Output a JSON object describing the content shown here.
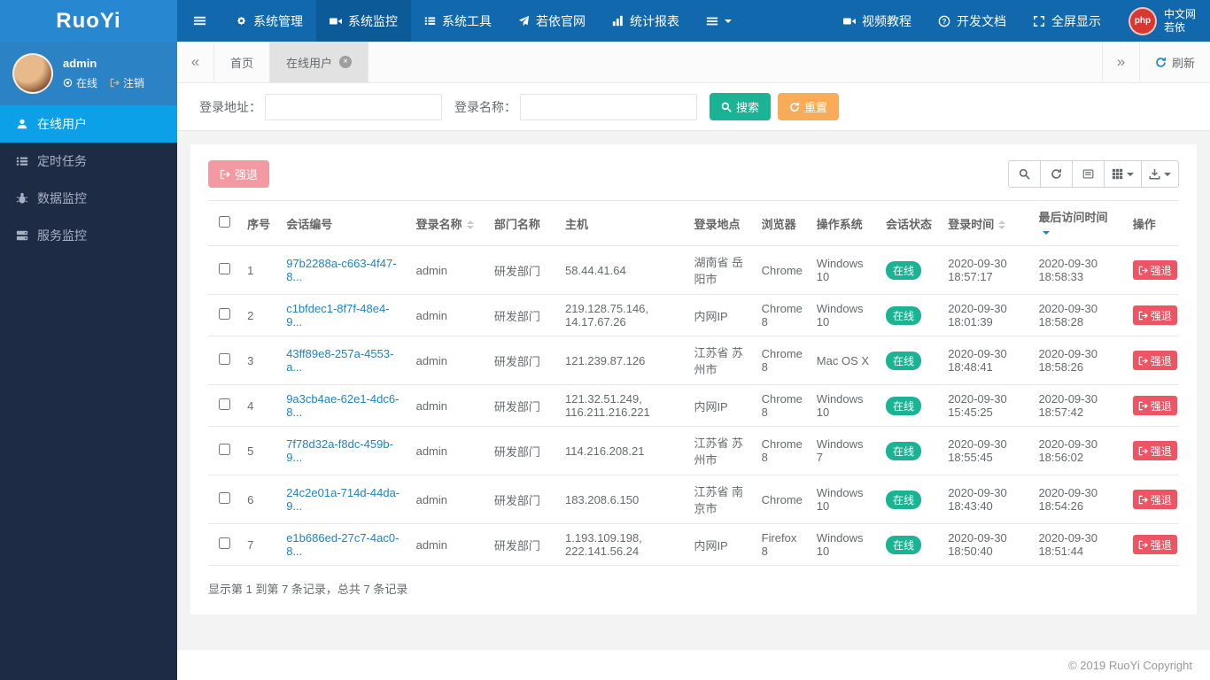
{
  "colors": {
    "primary": "#1ab394",
    "warning": "#f8ac59",
    "danger": "#ed5565",
    "link": "#1c84c6",
    "side-active": "#0ca0e9",
    "navbar": "#1168ad",
    "logo-blue": "#2787d0"
  },
  "brand": {
    "logo": "RuoYi"
  },
  "topnav": {
    "menu": [
      {
        "label": "系统管理",
        "icon": "gear-icon"
      },
      {
        "label": "系统监控",
        "icon": "video-camera-icon",
        "active": true
      },
      {
        "label": "系统工具",
        "icon": "list-icon"
      },
      {
        "label": "若依官网",
        "icon": "paper-plane-icon"
      },
      {
        "label": "统计报表",
        "icon": "bar-chart-icon"
      }
    ],
    "right_menu": [
      {
        "label": "视频教程",
        "icon": "video-icon"
      },
      {
        "label": "开发文档",
        "icon": "question-circle-icon"
      },
      {
        "label": "全屏显示",
        "icon": "fullscreen-icon"
      }
    ],
    "user": {
      "avatar_text": "php",
      "site": "中文网",
      "name": "若依"
    }
  },
  "sidebar": {
    "user": {
      "name": "admin",
      "status_label": "在线",
      "logout_label": "注销"
    },
    "menu": [
      {
        "label": "在线用户",
        "icon": "user-icon",
        "active": true
      },
      {
        "label": "定时任务",
        "icon": "tasks-icon"
      },
      {
        "label": "数据监控",
        "icon": "bug-icon"
      },
      {
        "label": "服务监控",
        "icon": "server-icon"
      }
    ]
  },
  "tabs": {
    "items": [
      {
        "label": "首页",
        "active": false
      },
      {
        "label": "在线用户",
        "active": true,
        "closable": true
      }
    ],
    "refresh_label": "刷新"
  },
  "search": {
    "address_label": "登录地址：",
    "address_value": "",
    "address_placeholder": "",
    "name_label": "登录名称：",
    "name_value": "",
    "name_placeholder": "",
    "search_label": "搜索",
    "reset_label": "重置"
  },
  "toolbar": {
    "force_logout_label": "强退",
    "icons": [
      "search-icon",
      "refresh-icon",
      "detail-view-icon",
      "columns-icon",
      "export-icon"
    ]
  },
  "table": {
    "headers": [
      {
        "label": "序号",
        "sortable": false
      },
      {
        "label": "会话编号",
        "sortable": false
      },
      {
        "label": "登录名称",
        "sortable": true
      },
      {
        "label": "部门名称",
        "sortable": false
      },
      {
        "label": "主机",
        "sortable": false
      },
      {
        "label": "登录地点",
        "sortable": false
      },
      {
        "label": "浏览器",
        "sortable": false
      },
      {
        "label": "操作系统",
        "sortable": false
      },
      {
        "label": "会话状态",
        "sortable": false
      },
      {
        "label": "登录时间",
        "sortable": true
      },
      {
        "label": "最后访问时间",
        "sortable": true,
        "sorted": "desc"
      },
      {
        "label": "操作",
        "sortable": false
      }
    ],
    "rows": [
      {
        "num": "1",
        "session": "97b2288a-c663-4f47-8...",
        "name": "admin",
        "dept": "研发部门",
        "host": "58.44.41.64",
        "location": "湖南省 岳阳市",
        "browser": "Chrome",
        "os": "Windows 10",
        "status": "在线",
        "login_time": "2020-09-30 18:57:17",
        "last_access": "2020-09-30 18:58:33",
        "action": "强退"
      },
      {
        "num": "2",
        "session": "c1bfdec1-8f7f-48e4-9...",
        "name": "admin",
        "dept": "研发部门",
        "host": "219.128.75.146, 14.17.67.26",
        "location": "内网IP",
        "browser": "Chrome 8",
        "os": "Windows 10",
        "status": "在线",
        "login_time": "2020-09-30 18:01:39",
        "last_access": "2020-09-30 18:58:28",
        "action": "强退"
      },
      {
        "num": "3",
        "session": "43ff89e8-257a-4553-a...",
        "name": "admin",
        "dept": "研发部门",
        "host": "121.239.87.126",
        "location": "江苏省 苏州市",
        "browser": "Chrome 8",
        "os": "Mac OS X",
        "status": "在线",
        "login_time": "2020-09-30 18:48:41",
        "last_access": "2020-09-30 18:58:26",
        "action": "强退"
      },
      {
        "num": "4",
        "session": "9a3cb4ae-62e1-4dc6-8...",
        "name": "admin",
        "dept": "研发部门",
        "host": "121.32.51.249, 116.211.216.221",
        "location": "内网IP",
        "browser": "Chrome 8",
        "os": "Windows 10",
        "status": "在线",
        "login_time": "2020-09-30 15:45:25",
        "last_access": "2020-09-30 18:57:42",
        "action": "强退"
      },
      {
        "num": "5",
        "session": "7f78d32a-f8dc-459b-9...",
        "name": "admin",
        "dept": "研发部门",
        "host": "114.216.208.21",
        "location": "江苏省 苏州市",
        "browser": "Chrome 8",
        "os": "Windows 7",
        "status": "在线",
        "login_time": "2020-09-30 18:55:45",
        "last_access": "2020-09-30 18:56:02",
        "action": "强退"
      },
      {
        "num": "6",
        "session": "24c2e01a-714d-44da-9...",
        "name": "admin",
        "dept": "研发部门",
        "host": "183.208.6.150",
        "location": "江苏省 南京市",
        "browser": "Chrome",
        "os": "Windows 10",
        "status": "在线",
        "login_time": "2020-09-30 18:43:40",
        "last_access": "2020-09-30 18:54:26",
        "action": "强退"
      },
      {
        "num": "7",
        "session": "e1b686ed-27c7-4ac0-8...",
        "name": "admin",
        "dept": "研发部门",
        "host": "1.193.109.198, 222.141.56.24",
        "location": "内网IP",
        "browser": "Firefox 8",
        "os": "Windows 10",
        "status": "在线",
        "login_time": "2020-09-30 18:50:40",
        "last_access": "2020-09-30 18:51:44",
        "action": "强退"
      }
    ],
    "summary": "显示第 1 到第 7 条记录，总共 7 条记录"
  },
  "footer": {
    "copyright": "© 2019 RuoYi Copyright"
  }
}
